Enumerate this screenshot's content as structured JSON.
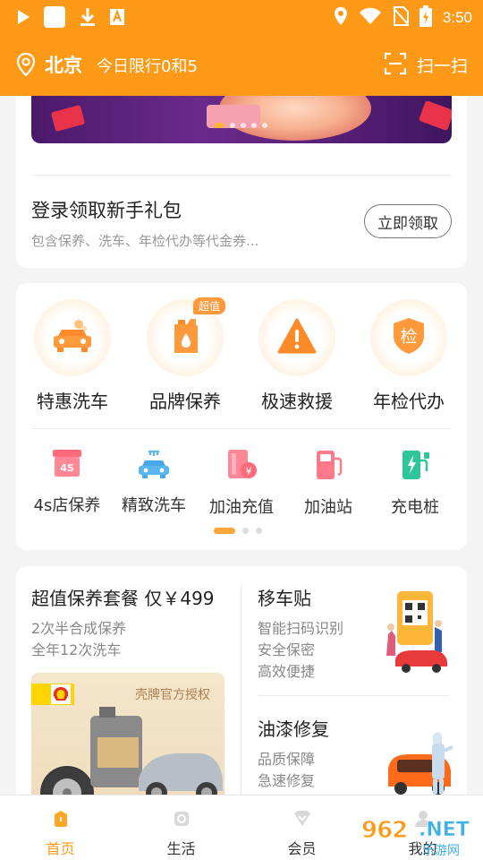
{
  "status_bar": {
    "time": "3:50",
    "icons": [
      "play-icon",
      "square-app-icon",
      "download-icon",
      "a-icon",
      "location-icon",
      "wifi-icon",
      "no-sim-icon",
      "battery-charging-icon"
    ]
  },
  "header": {
    "city": "北京",
    "limit_text": "今日限行0和5",
    "scan_label": "扫一扫"
  },
  "login_card": {
    "title": "登录领取新手礼包",
    "subtitle": "包含保养、洗车、年检代办等代金券...",
    "button": "立即领取"
  },
  "services": {
    "primary": [
      {
        "label": "特惠洗车",
        "icon": "car-wash-icon"
      },
      {
        "label": "品牌保养",
        "icon": "oil-can-icon",
        "badge": "超值"
      },
      {
        "label": "极速救援",
        "icon": "warning-icon"
      },
      {
        "label": "年检代办",
        "icon": "inspection-shield-icon",
        "icon_text": "检"
      }
    ],
    "secondary": [
      {
        "label": "4s店保养",
        "icon": "4s-store-icon",
        "icon_text": "4S"
      },
      {
        "label": "精致洗车",
        "icon": "car-shower-icon"
      },
      {
        "label": "加油充值",
        "icon": "fuel-card-icon"
      },
      {
        "label": "加油站",
        "icon": "gas-pump-icon"
      },
      {
        "label": "充电桩",
        "icon": "charging-pile-icon"
      }
    ],
    "page_count": 3,
    "active_page": 1
  },
  "promo": {
    "package": {
      "title": "超值保养套餐 仅￥499",
      "lines": [
        "2次半合成保养",
        "全年12次洗车"
      ],
      "brand_auth": "壳牌官方授权"
    },
    "sticker": {
      "title": "移车贴",
      "lines": [
        "智能扫码识别",
        "安全保密",
        "高效便捷"
      ]
    },
    "paint": {
      "title": "油漆修复",
      "lines": [
        "品质保障",
        "急速修复"
      ]
    }
  },
  "bottom_nav": [
    {
      "label": "首页",
      "icon": "home-icon",
      "active": true
    },
    {
      "label": "生活",
      "icon": "life-icon",
      "active": false
    },
    {
      "label": "会员",
      "icon": "member-icon",
      "active": false
    },
    {
      "label": "我的",
      "icon": "profile-icon",
      "active": false
    }
  ],
  "watermark": {
    "number": "962",
    "domain": ".NET",
    "caption": "乐游网"
  },
  "colors": {
    "brand": "#ff9a18",
    "badge": "#ff9a3c",
    "banner": "#5a2078"
  }
}
